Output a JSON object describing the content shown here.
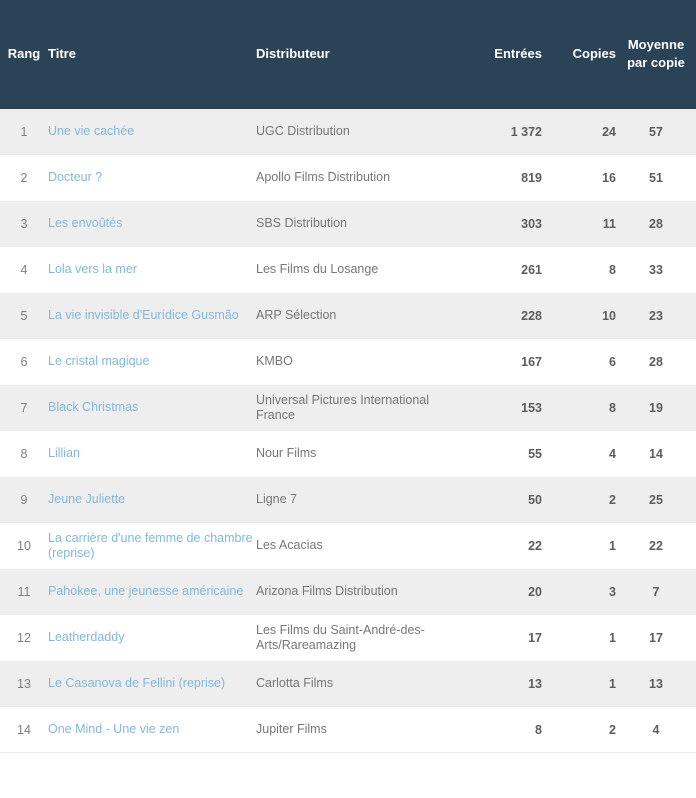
{
  "colors": {
    "header_bg": "#2b4356",
    "header_text": "#ffffff",
    "row_alt_bg": "#eeeeee",
    "row_bg": "#ffffff",
    "link": "#81b9de",
    "distributor_text": "#777777",
    "number_text": "#5d5d5d",
    "rank_text": "#808080"
  },
  "table": {
    "columns": [
      {
        "key": "rank",
        "label": "Rang",
        "align": "center"
      },
      {
        "key": "title",
        "label": "Titre",
        "align": "left"
      },
      {
        "key": "distributor",
        "label": "Distributeur",
        "align": "left"
      },
      {
        "key": "entries",
        "label": "Entrées",
        "align": "right"
      },
      {
        "key": "copies",
        "label": "Copies",
        "align": "right"
      },
      {
        "key": "average_per_copy",
        "label": "Moyenne par copie",
        "align": "center"
      }
    ],
    "rows": [
      {
        "rank": "1",
        "title": "Une vie cachée",
        "distributor": "UGC Distribution",
        "entries": "1 372",
        "copies": "24",
        "average_per_copy": "57"
      },
      {
        "rank": "2",
        "title": "Docteur ?",
        "distributor": "Apollo Films Distribution",
        "entries": "819",
        "copies": "16",
        "average_per_copy": "51"
      },
      {
        "rank": "3",
        "title": "Les envoûtés",
        "distributor": "SBS Distribution",
        "entries": "303",
        "copies": "11",
        "average_per_copy": "28"
      },
      {
        "rank": "4",
        "title": "Lola vers la mer",
        "distributor": "Les Films du Losange",
        "entries": "261",
        "copies": "8",
        "average_per_copy": "33"
      },
      {
        "rank": "5",
        "title": "La vie invisible d'Eurídice Gusmão",
        "distributor": "ARP Sélection",
        "entries": "228",
        "copies": "10",
        "average_per_copy": "23"
      },
      {
        "rank": "6",
        "title": "Le cristal magique",
        "distributor": "KMBO",
        "entries": "167",
        "copies": "6",
        "average_per_copy": "28"
      },
      {
        "rank": "7",
        "title": "Black Christmas",
        "distributor": "Universal Pictures International France",
        "entries": "153",
        "copies": "8",
        "average_per_copy": "19"
      },
      {
        "rank": "8",
        "title": "Lillian",
        "distributor": "Nour Films",
        "entries": "55",
        "copies": "4",
        "average_per_copy": "14"
      },
      {
        "rank": "9",
        "title": "Jeune Juliette",
        "distributor": "Ligne 7",
        "entries": "50",
        "copies": "2",
        "average_per_copy": "25"
      },
      {
        "rank": "10",
        "title": "La carrière d'une femme de chambre (reprise)",
        "distributor": "Les Acacias",
        "entries": "22",
        "copies": "1",
        "average_per_copy": "22"
      },
      {
        "rank": "11",
        "title": "Pahokee, une jeunesse américaine",
        "distributor": "Arizona Films Distribution",
        "entries": "20",
        "copies": "3",
        "average_per_copy": "7"
      },
      {
        "rank": "12",
        "title": "Leatherdaddy",
        "distributor": "Les Films du Saint-André-des-Arts/Rareamazing",
        "entries": "17",
        "copies": "1",
        "average_per_copy": "17"
      },
      {
        "rank": "13",
        "title": "Le Casanova de Fellini (reprise)",
        "distributor": "Carlotta Films",
        "entries": "13",
        "copies": "1",
        "average_per_copy": "13"
      },
      {
        "rank": "14",
        "title": "One Mind - Une vie zen",
        "distributor": "Jupiter Films",
        "entries": "8",
        "copies": "2",
        "average_per_copy": "4"
      }
    ]
  }
}
